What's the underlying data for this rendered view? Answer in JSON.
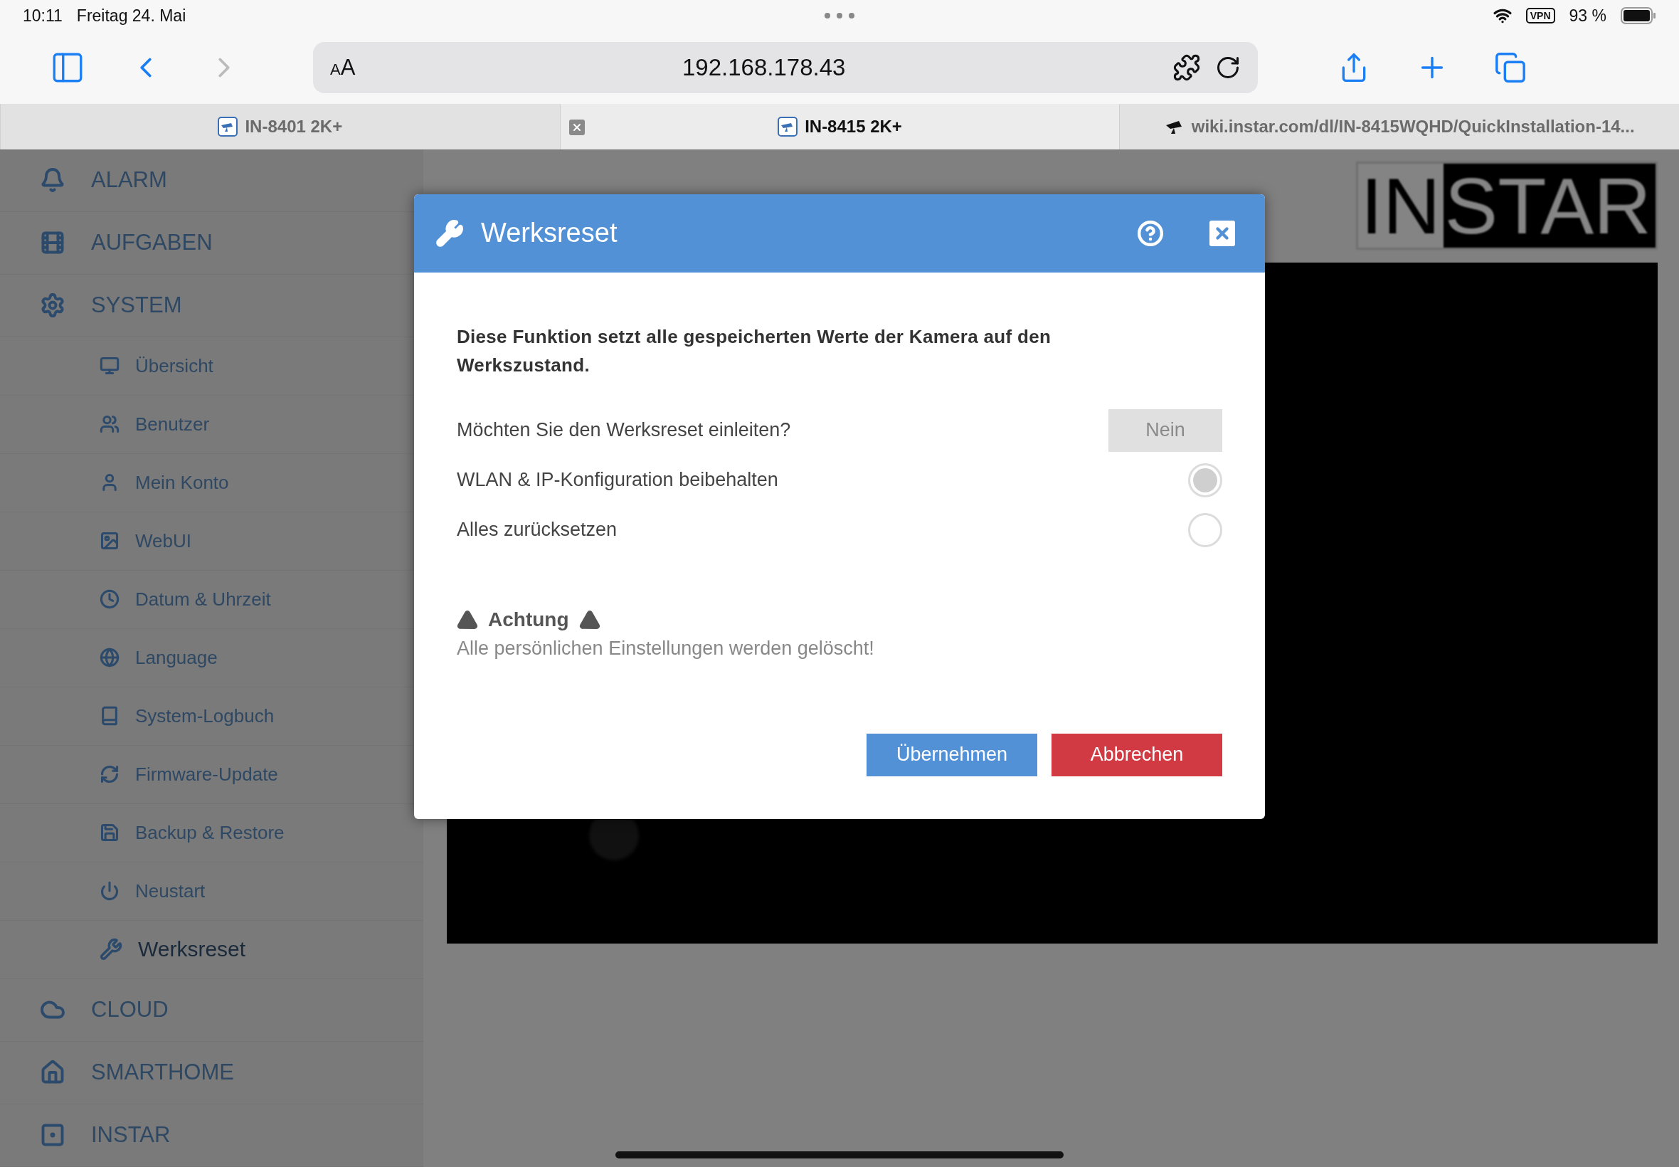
{
  "status_bar": {
    "time": "10:11",
    "date": "Freitag 24. Mai",
    "vpn": "VPN",
    "battery": "93 %"
  },
  "toolbar": {
    "reader": {
      "small": "A",
      "large": "A"
    },
    "url": "192.168.178.43"
  },
  "tabs": [
    {
      "title": "IN-8401 2K+",
      "selected": false,
      "kind": "camera"
    },
    {
      "title": "IN-8415 2K+",
      "selected": true,
      "kind": "camera"
    },
    {
      "title": "wiki.instar.com/dl/IN-8415WQHD/QuickInstallation-14...",
      "selected": false,
      "kind": "wiki"
    }
  ],
  "sidebar": {
    "items": [
      {
        "label": "ALARM",
        "selected": false
      },
      {
        "label": "AUFGABEN",
        "selected": false
      },
      {
        "label": "SYSTEM",
        "selected": false,
        "expanded": true,
        "children": [
          {
            "label": "Übersicht",
            "selected": false
          },
          {
            "label": "Benutzer",
            "selected": false
          },
          {
            "label": "Mein Konto",
            "selected": false
          },
          {
            "label": "WebUI",
            "selected": false
          },
          {
            "label": "Datum & Uhrzeit",
            "selected": false
          },
          {
            "label": "Language",
            "selected": false
          },
          {
            "label": "System-Logbuch",
            "selected": false
          },
          {
            "label": "Firmware-Update",
            "selected": false
          },
          {
            "label": "Backup & Restore",
            "selected": false
          },
          {
            "label": "Neustart",
            "selected": false
          },
          {
            "label": "Werksreset",
            "selected": true
          }
        ]
      },
      {
        "label": "CLOUD",
        "selected": false
      },
      {
        "label": "SMARTHOME",
        "selected": false
      },
      {
        "label": "INSTAR",
        "selected": false
      }
    ]
  },
  "logo": {
    "part_1": "IN",
    "part_2": "STAR"
  },
  "dialog": {
    "title": "Werksreset",
    "description": "Diese Funktion setzt alle gespeicherten Werte der Kamera auf den Werkszustand.",
    "question": {
      "label": "Möchten Sie den Werksreset einleiten?",
      "toggle": "Nein"
    },
    "options": [
      {
        "label": "WLAN & IP-Konfiguration beibehalten",
        "selected": true
      },
      {
        "label": "Alles zurücksetzen",
        "selected": false
      }
    ],
    "warning": {
      "title": "Achtung",
      "message": "Alle persönlichen Einstellungen werden gelöscht!"
    },
    "buttons": [
      {
        "label": "Übernehmen",
        "kind": "apply"
      },
      {
        "label": "Abbrechen",
        "kind": "cancel"
      }
    ]
  }
}
